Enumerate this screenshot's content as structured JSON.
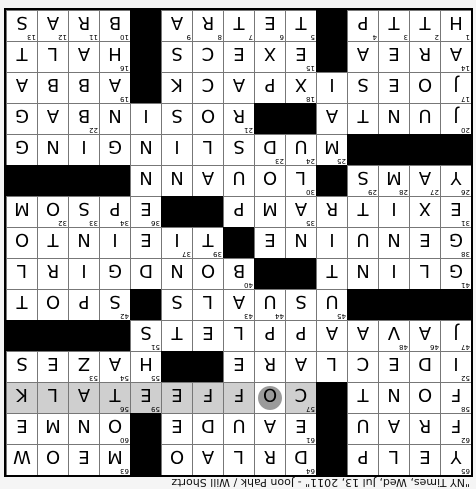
{
  "title": "\"NY Times, Wed, Jul 13, 2011\" - Joon Pahk / Will Shortz",
  "selected": {
    "row": 2,
    "col": 6
  },
  "highlight": {
    "row": 2,
    "cols": [
      5,
      6,
      7,
      8,
      9,
      10,
      11,
      12,
      13,
      14
    ]
  },
  "colors": {
    "block": "#000000",
    "highlight": "#cfcfcf",
    "cell": "#ffffff"
  },
  "grid": [
    "YELP#DRLAO#MEOW",
    "FRAU#EAUDE#ONME",
    "FONT#COFFEETALK",
    "IDECLARE##HAZES",
    "JAVAAPPLETS####",
    "####USUALS#SPOT",
    "GLINT##BONDGIRL",
    "GENUINE#TIEINTO",
    "EXITRAMP##EPSOM",
    "YAMS#LOUANN####",
    "####MUDSLINGING",
    "JUNTA##ROSINBAG",
    "JOESIXPACK#ABBA",
    "AREA#EXECS#HALT",
    "HTTP#TETRA#BRAS"
  ],
  "numbers": [
    [
      65,
      0,
      0,
      0,
      null,
      64,
      0,
      0,
      0,
      0,
      null,
      63,
      0,
      0,
      0
    ],
    [
      62,
      0,
      0,
      0,
      null,
      61,
      0,
      0,
      0,
      0,
      null,
      60,
      0,
      0,
      0
    ],
    [
      58,
      0,
      0,
      0,
      null,
      57,
      0,
      0,
      0,
      0,
      59,
      56,
      0,
      0,
      0
    ],
    [
      52,
      0,
      0,
      0,
      0,
      0,
      0,
      0,
      null,
      null,
      55,
      54,
      53,
      0,
      0
    ],
    [
      47,
      46,
      48,
      0,
      0,
      0,
      0,
      0,
      0,
      0,
      51,
      null,
      null,
      null,
      null
    ],
    [
      null,
      null,
      null,
      null,
      45,
      0,
      44,
      43,
      0,
      0,
      null,
      42,
      0,
      0,
      0
    ],
    [
      41,
      0,
      0,
      0,
      0,
      null,
      null,
      40,
      0,
      0,
      0,
      0,
      0,
      0,
      0
    ],
    [
      38,
      0,
      0,
      0,
      0,
      0,
      0,
      null,
      39,
      37,
      0,
      0,
      0,
      0,
      0
    ],
    [
      31,
      0,
      0,
      0,
      0,
      35,
      0,
      0,
      null,
      null,
      36,
      34,
      33,
      32,
      0
    ],
    [
      26,
      27,
      28,
      29,
      null,
      30,
      0,
      0,
      0,
      0,
      0,
      null,
      null,
      null,
      null
    ],
    [
      null,
      null,
      null,
      null,
      25,
      24,
      23,
      0,
      0,
      0,
      0,
      0,
      0,
      0,
      0
    ],
    [
      20,
      0,
      0,
      0,
      0,
      null,
      null,
      21,
      0,
      0,
      0,
      0,
      22,
      0,
      0
    ],
    [
      17,
      0,
      0,
      0,
      0,
      18,
      0,
      0,
      0,
      0,
      null,
      19,
      0,
      0,
      0
    ],
    [
      14,
      0,
      0,
      0,
      null,
      15,
      0,
      0,
      0,
      0,
      null,
      16,
      0,
      0,
      0
    ],
    [
      1,
      2,
      3,
      4,
      null,
      5,
      6,
      7,
      8,
      9,
      null,
      10,
      11,
      12,
      13
    ]
  ]
}
